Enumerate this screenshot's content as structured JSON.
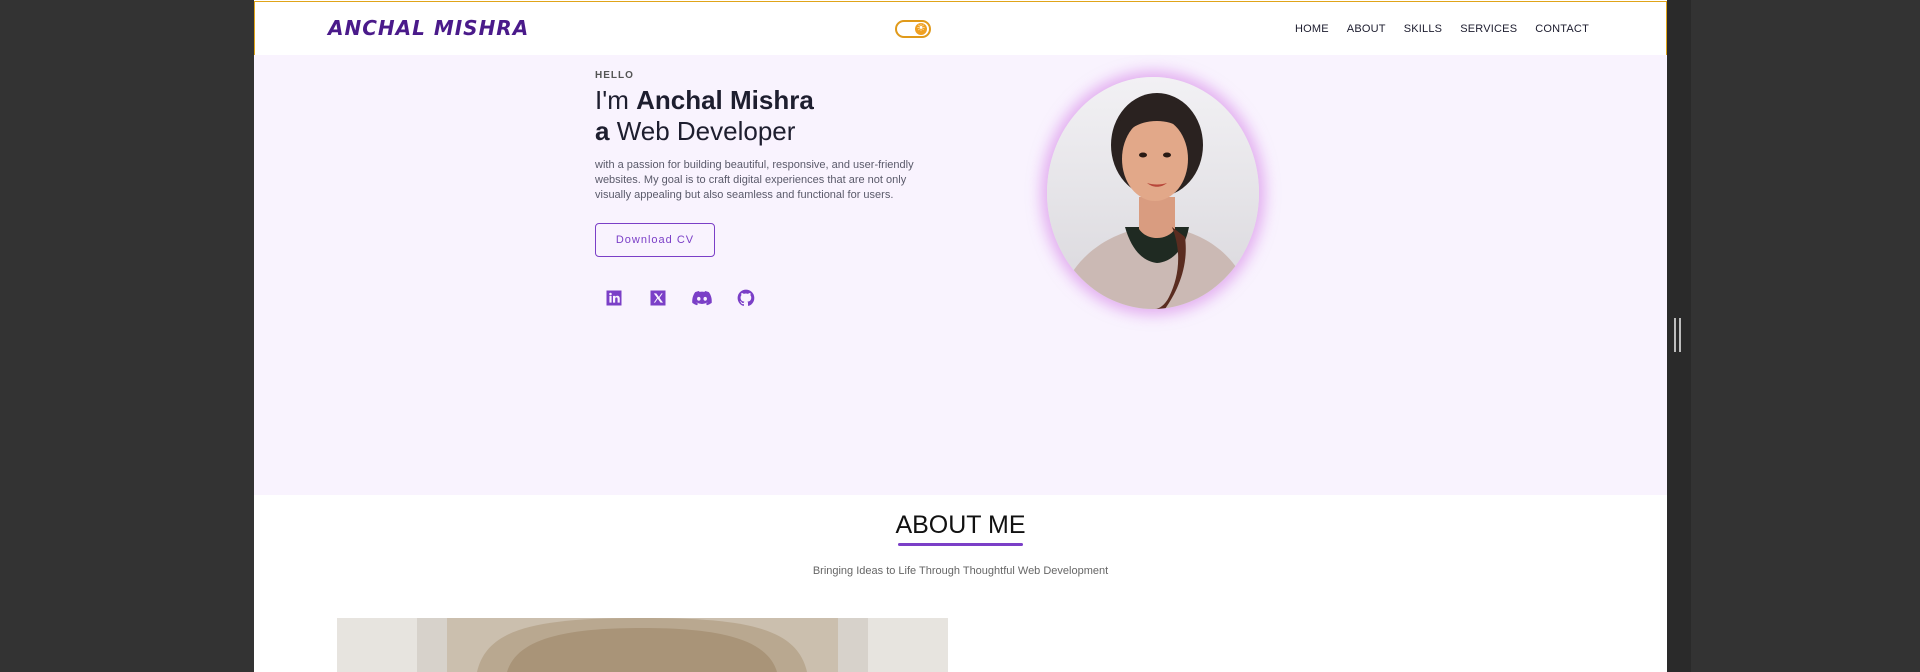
{
  "brand": {
    "logo_text": "ANCHAL MISHRA"
  },
  "theme_toggle": {
    "icon": "sun-icon",
    "accent": "#e09a1a"
  },
  "nav": {
    "links": [
      {
        "label": "HOME"
      },
      {
        "label": "ABOUT"
      },
      {
        "label": "SKILLS"
      },
      {
        "label": "SERVICES"
      },
      {
        "label": "CONTACT"
      }
    ]
  },
  "hero": {
    "greeting": "HELLO",
    "line1_prefix": "I'm ",
    "line1_name": "Anchal Mishra",
    "line2_prefix": "a",
    "line2_role": " Web Developer",
    "intro": "with a passion for building beautiful, responsive, and user-friendly websites. My goal is to craft digital experiences that are not only visually appealing but also seamless and functional for users.",
    "cta_label": "Download CV",
    "socials": [
      {
        "icon": "linkedin-icon"
      },
      {
        "icon": "x-twitter-icon"
      },
      {
        "icon": "discord-icon"
      },
      {
        "icon": "github-icon"
      }
    ],
    "accent": "#7b3fc7",
    "background": "#f9f3fe"
  },
  "about": {
    "title": "ABOUT ME",
    "subtitle": "Bringing Ideas to Life Through Thoughtful Web Development"
  }
}
